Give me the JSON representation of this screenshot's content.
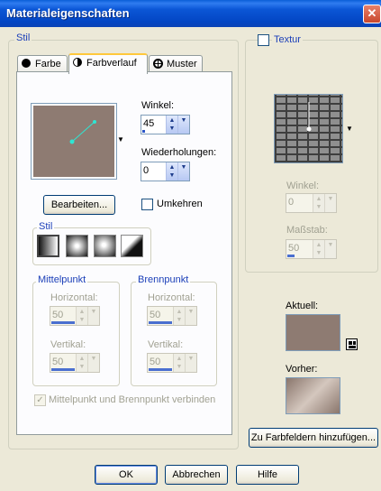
{
  "window": {
    "title": "Materialeigenschaften",
    "close_glyph": "✕"
  },
  "stil_group": {
    "legend": "Stil"
  },
  "tabs": [
    {
      "label": "Farbe",
      "icon": "color-dot-icon"
    },
    {
      "label": "Farbverlauf",
      "icon": "gradient-half-icon"
    },
    {
      "label": "Muster",
      "icon": "pattern-icon"
    }
  ],
  "gradient": {
    "winkel_label": "Winkel:",
    "winkel_value": "45",
    "winkel_level": 0.125,
    "wiederholungen_label": "Wiederholungen:",
    "wiederholungen_value": "0",
    "wiederholungen_level": 0,
    "edit_button": "Bearbeiten...",
    "umkehren_label": "Umkehren",
    "umkehren_checked": false,
    "stil_legend": "Stil",
    "style_buttons": [
      "linear-gradient-style",
      "rectangular-gradient-style",
      "sunburst-gradient-style",
      "radial-gradient-style"
    ],
    "mittelpunkt": {
      "legend": "Mittelpunkt",
      "horizontal_label": "Horizontal:",
      "horizontal_value": "50",
      "vertikal_label": "Vertikal:",
      "vertikal_value": "50"
    },
    "brennpunkt": {
      "legend": "Brennpunkt",
      "horizontal_label": "Horizontal:",
      "horizontal_value": "50",
      "vertikal_label": "Vertikal:",
      "vertikal_value": "50"
    },
    "link_label": "Mittelpunkt und Brennpunkt verbinden",
    "link_checked": true,
    "colors": {
      "start": "#8e7b72",
      "end": "#8e7b72",
      "handle": "#2ee6d3"
    }
  },
  "textur": {
    "label": "Textur",
    "checked": false,
    "winkel_label": "Winkel:",
    "winkel_value": "0",
    "massstab_label": "Maßstab:",
    "massstab_value": "50"
  },
  "aktuell_label": "Aktuell:",
  "vorher_label": "Vorher:",
  "add_swatch_button": "Zu Farbfeldern hinzufügen...",
  "footer": {
    "ok": "OK",
    "cancel": "Abbrechen",
    "help": "Hilfe"
  },
  "colors": {
    "title_bar": "#0a4fd0",
    "accent": "#1b3fb8",
    "window_bg": "#ece9d8"
  }
}
